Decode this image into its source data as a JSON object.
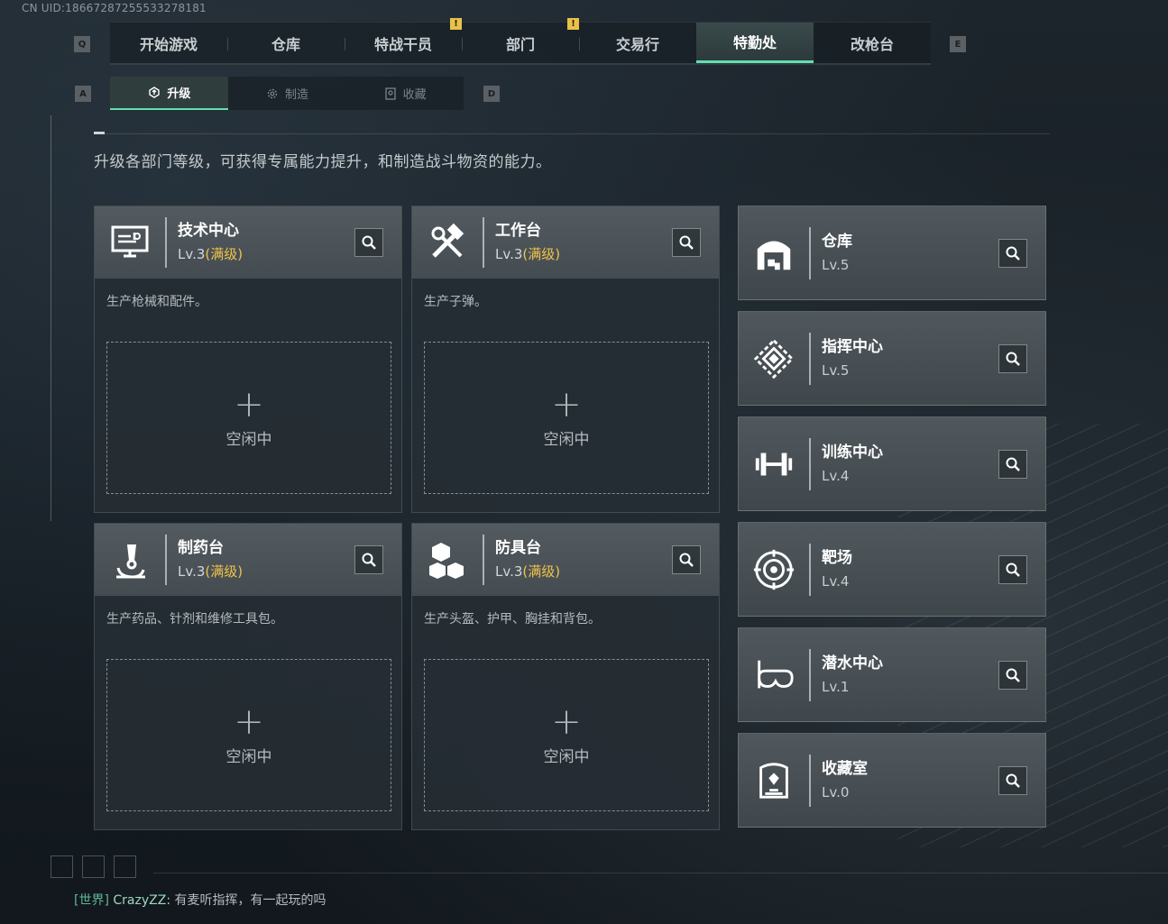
{
  "uid": "CN UID:18667287255533278181",
  "hotkeys": {
    "prev_tab": "Q",
    "next_tab": "E",
    "prev_sub": "A",
    "next_sub": "D"
  },
  "tabs": [
    {
      "label": "开始游戏",
      "active": false,
      "alert": false
    },
    {
      "label": "仓库",
      "active": false,
      "alert": false
    },
    {
      "label": "特战干员",
      "active": false,
      "alert": true
    },
    {
      "label": "部门",
      "active": false,
      "alert": true
    },
    {
      "label": "交易行",
      "active": false,
      "alert": false
    },
    {
      "label": "特勤处",
      "active": true,
      "alert": false
    },
    {
      "label": "改枪台",
      "active": false,
      "alert": false
    }
  ],
  "alert_mark": "!",
  "subtabs": [
    {
      "label": "升级",
      "icon": "upgrade-icon",
      "active": true
    },
    {
      "label": "制造",
      "icon": "craft-gear-icon",
      "active": false
    },
    {
      "label": "收藏",
      "icon": "collection-icon",
      "active": false
    }
  ],
  "description": "升级各部门等级，可获得专属能力提升，和制造战斗物资的能力。",
  "workshops": [
    {
      "name": "技术中心",
      "level": "Lv.3",
      "max": "(满级)",
      "desc": "生产枪械和配件。",
      "plus": "+",
      "slot": "空闲中",
      "icon": "computer-icon"
    },
    {
      "name": "工作台",
      "level": "Lv.3",
      "max": "(满级)",
      "desc": "生产子弹。",
      "plus": "+",
      "slot": "空闲中",
      "icon": "hammer-wrench-icon"
    },
    {
      "name": "制药台",
      "level": "Lv.3",
      "max": "(满级)",
      "desc": "生产药品、针剂和维修工具包。",
      "plus": "+",
      "slot": "空闲中",
      "icon": "microscope-icon"
    },
    {
      "name": "防具台",
      "level": "Lv.3",
      "max": "(满级)",
      "desc": "生产头盔、护甲、胸挂和背包。",
      "plus": "+",
      "slot": "空闲中",
      "icon": "cubes-icon"
    }
  ],
  "facilities": [
    {
      "name": "仓库",
      "level": "Lv.5",
      "icon": "warehouse-icon"
    },
    {
      "name": "指挥中心",
      "level": "Lv.5",
      "icon": "command-center-icon"
    },
    {
      "name": "训练中心",
      "level": "Lv.4",
      "icon": "dumbbell-icon"
    },
    {
      "name": "靶场",
      "level": "Lv.4",
      "icon": "target-icon"
    },
    {
      "name": "潜水中心",
      "level": "Lv.1",
      "icon": "diving-mask-icon"
    },
    {
      "name": "收藏室",
      "level": "Lv.0",
      "icon": "display-case-icon"
    }
  ],
  "chat": {
    "channel": "[世界]",
    "name": "CrazyZZ:",
    "message": "有麦听指挥，有一起玩的吗"
  },
  "colors": {
    "accent": "#5fe0b0",
    "max_level": "#f0c24a",
    "alert": "#e8c14a"
  }
}
